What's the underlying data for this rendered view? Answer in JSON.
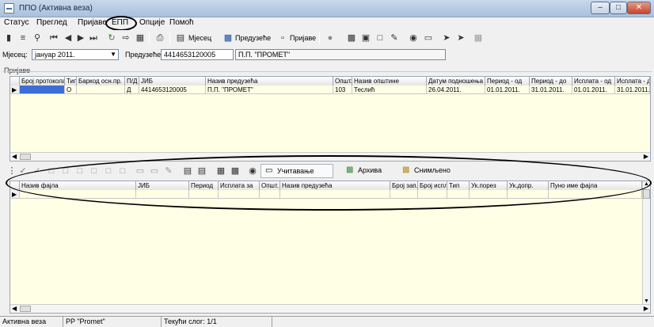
{
  "window": {
    "title": "ППО (Активна веза)"
  },
  "menu": [
    "Статус",
    "Преглед",
    "Пријаве",
    "ЕПП",
    "Опције",
    "Помоћ"
  ],
  "toolbar": {
    "month_label": "Мјесец",
    "company_label": "Предузеће",
    "returns_label": "Пријаве"
  },
  "filter": {
    "month_label": "Мјесец:",
    "month_value": "јануар 2011.",
    "company_label": "Предузеће:",
    "company_id": "4414653120005",
    "company_name": "П.П. \"ПРОМЕТ\""
  },
  "upper_grid": {
    "group": "Пријаве",
    "columns": [
      "Број протокола",
      "Тип",
      "Баркод осн.пр.",
      "П/Д",
      "ЈИБ",
      "Назив предузећа",
      "Општ.",
      "Назив општине",
      "Датум подношења",
      "Период - од",
      "Период - до",
      "Исплата - од",
      "Исплата - до"
    ],
    "rows": [
      [
        "",
        "О",
        "",
        "Д",
        "4414653120005",
        "П.П. \"ПРОМЕТ\"",
        "103",
        "Теслић",
        "26.04.2011.",
        "01.01.2011.",
        "31.01.2011.",
        "01.01.2011.",
        "31.01.2011."
      ]
    ]
  },
  "lower_toolbar": {
    "load_label": "Учитавање",
    "archive_label": "Архива",
    "saved_label": "Снимљено"
  },
  "lower_grid": {
    "columns": [
      "Назив фајла",
      "ЈИБ",
      "Период",
      "Исплата за",
      "Општ.",
      "Назив предузећа",
      "Број зап.",
      "Број испл.",
      "Тип",
      "Ук.порез",
      "Ук.допр.",
      "Пуно име фајла"
    ]
  },
  "status": {
    "connection": "Активна веза",
    "company": "PP \"Promet\"",
    "record": "Текући слог: 1/1"
  },
  "colors": {
    "grid_bg": "#ffffe6",
    "selected_cell": "#3b6fd6",
    "title_gradient": "#b4c8e0"
  }
}
